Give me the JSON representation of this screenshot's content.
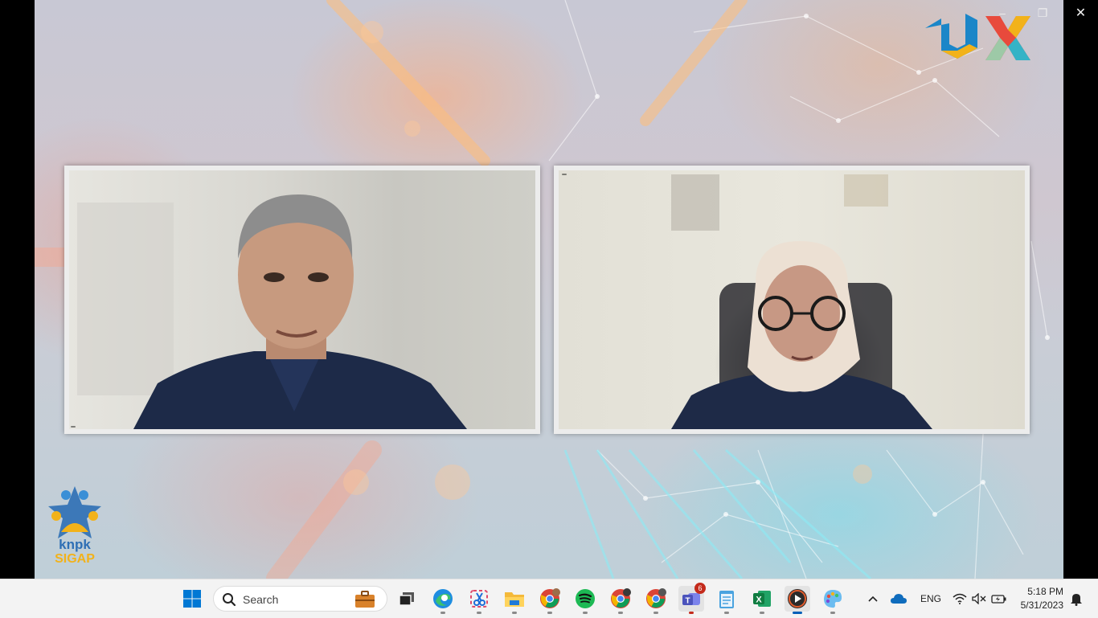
{
  "stage": {
    "left_name_tag": "",
    "right_name_tag": ""
  },
  "window_controls": {
    "minimize": "–",
    "restore": "❐",
    "close": "✕"
  },
  "taskbar": {
    "search_placeholder": "Search",
    "pinned": [
      {
        "name": "start",
        "icon": "windows-logo-icon"
      },
      {
        "name": "task-view",
        "icon": "task-view-icon"
      },
      {
        "name": "edge",
        "icon": "edge-icon"
      },
      {
        "name": "snipping-tool",
        "icon": "snipping-tool-icon"
      },
      {
        "name": "file-explorer",
        "icon": "folder-icon"
      },
      {
        "name": "chrome-1",
        "icon": "chrome-icon"
      },
      {
        "name": "spotify",
        "icon": "spotify-icon"
      },
      {
        "name": "chrome-2",
        "icon": "chrome-icon"
      },
      {
        "name": "chrome-3",
        "icon": "chrome-icon"
      },
      {
        "name": "teams",
        "icon": "teams-icon",
        "badge": "6"
      },
      {
        "name": "notepad",
        "icon": "notepad-icon"
      },
      {
        "name": "excel",
        "icon": "excel-icon"
      },
      {
        "name": "media-player",
        "icon": "media-player-icon"
      },
      {
        "name": "paint",
        "icon": "paint-icon"
      }
    ],
    "teams_badge": "6",
    "tray": {
      "language": "ENG",
      "time": "5:18 PM",
      "date": "5/31/2023"
    }
  },
  "colors": {
    "taskbar_bg": "#f3f3f3",
    "accent": "#005fb8",
    "badge": "#c42b1c",
    "frame": "#ececec"
  }
}
